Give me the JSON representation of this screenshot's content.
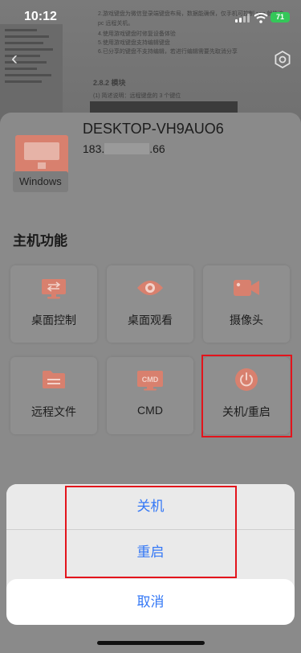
{
  "status_bar": {
    "time": "10:12",
    "battery": "71"
  },
  "background_doc": {
    "lines": [
      "2.游戏键盘为微信登录端键盘布局，数据能确保，仅手机可控制 app 就能连",
      "pc 远程关机。",
      "4.使用游戏键盘时修复设备体验",
      "5.使用游戏键盘支持编辑键盘",
      "6.已分享的键盘不支持编辑，若进行编辑需要先取消分享",
      "2.8.2 模块",
      "(1) 简述说明：远程键盘的 3 个键位"
    ]
  },
  "device": {
    "name": "DESKTOP-VH9AUO6",
    "ip_prefix": "183.",
    "ip_suffix": ".66",
    "os": "Windows"
  },
  "section_title": "主机功能",
  "features": [
    {
      "label": "桌面控制",
      "icon": "desktop-control-icon"
    },
    {
      "label": "桌面观看",
      "icon": "eye-icon"
    },
    {
      "label": "摄像头",
      "icon": "camera-icon"
    },
    {
      "label": "远程文件",
      "icon": "folder-icon"
    },
    {
      "label": "CMD",
      "icon": "cmd-icon",
      "icon_text": "CMD"
    },
    {
      "label": "关机/重启",
      "icon": "power-icon"
    }
  ],
  "action_sheet": {
    "options": [
      "关机",
      "重启"
    ],
    "cancel": "取消"
  },
  "colors": {
    "accent": "#d8806e",
    "action_blue": "#3478f6",
    "highlight_red": "#e3141c",
    "battery_green": "#34c759"
  }
}
